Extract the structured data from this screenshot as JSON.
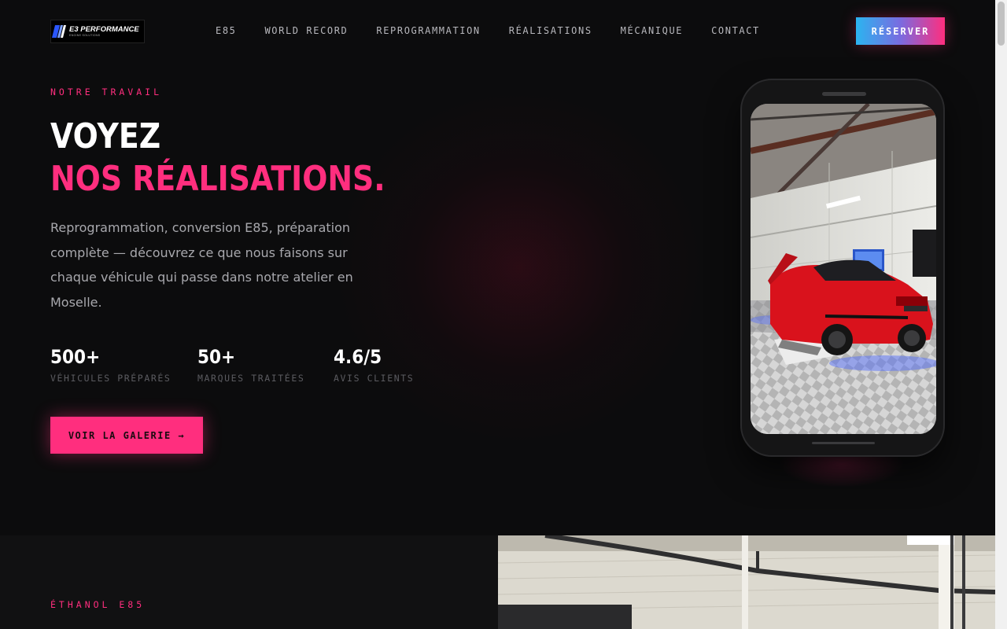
{
  "brand": {
    "logo_title": "E3 PERFORMANCE",
    "logo_subtitle": "ENGINE SOLUTIONS"
  },
  "nav": {
    "items": [
      "E85",
      "WORLD RECORD",
      "REPROGRAMMATION",
      "RÉALISATIONS",
      "MÉCANIQUE",
      "CONTACT"
    ],
    "cta_label": "RÉSERVER"
  },
  "hero": {
    "eyebrow": "NOTRE TRAVAIL",
    "title_line1": "VOYEZ",
    "title_line2": "NOS RÉALISATIONS.",
    "description": "Reprogrammation, conversion E85, préparation complète — découvrez ce que nous faisons sur chaque véhicule qui passe dans notre atelier en Moselle.",
    "stats": [
      {
        "value": "500+",
        "label": "VÉHICULES PRÉPARÉS"
      },
      {
        "value": "50+",
        "label": "MARQUES TRAITÉES"
      },
      {
        "value": "4.6/5",
        "label": "AVIS CLIENTS"
      }
    ],
    "cta_label": "VOIR LA GALERIE →"
  },
  "section2": {
    "eyebrow": "ÉTHANOL E85"
  },
  "colors": {
    "accent": "#ff2e7e",
    "background": "#0c0c0d",
    "gradient_start": "#2bb4f0",
    "gradient_end": "#ff2e7e"
  },
  "icons": {
    "logo": "e3-performance-logo",
    "phone_image": "red-car-workshop-photo",
    "section_image": "workshop-photo"
  }
}
